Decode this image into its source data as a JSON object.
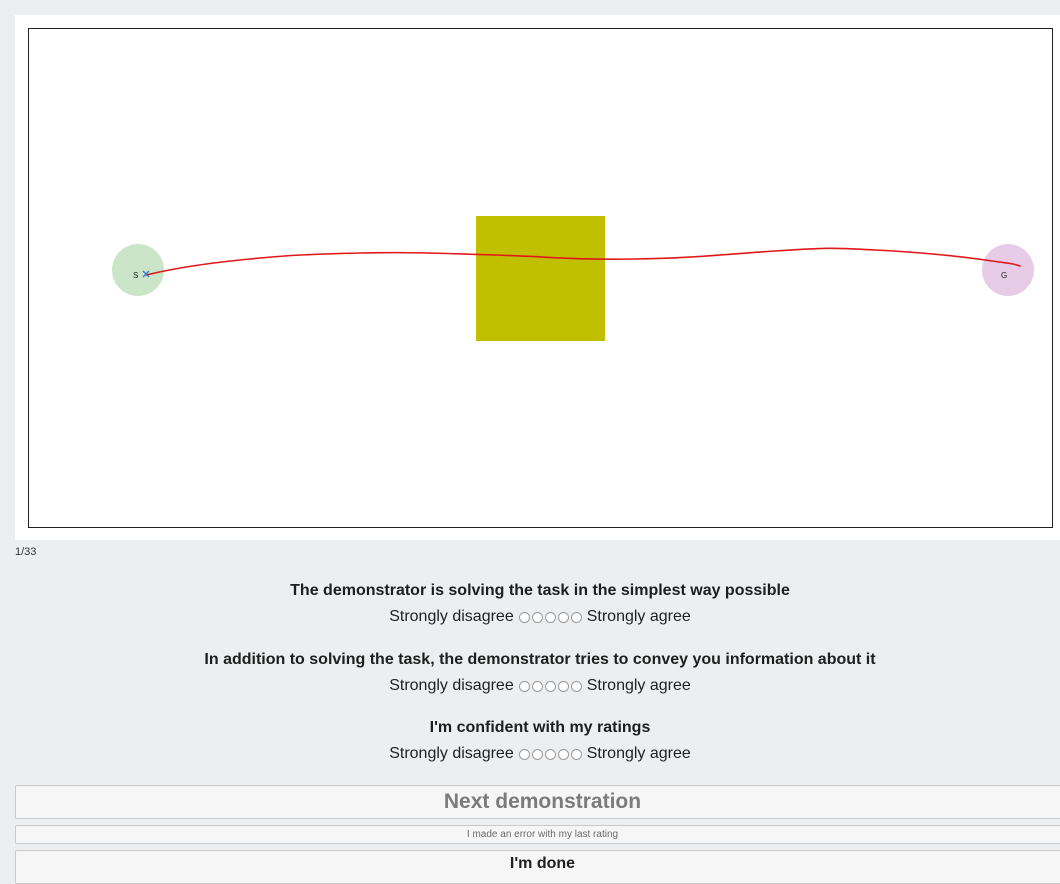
{
  "demo": {
    "start_label": "S",
    "goal_label": "G",
    "colors": {
      "start_circle": "#c5e2c3",
      "goal_circle": "#e5c7e4",
      "obstacle": "#c0c000",
      "trajectory": "#e01818",
      "start_marker": "#3a7ad0",
      "frame": "#222222"
    }
  },
  "progress": {
    "counter": "1/33"
  },
  "questions": [
    {
      "prompt": "The demonstrator is solving the task in the simplest way possible",
      "left_label": "Strongly disagree",
      "right_label": "Strongly agree",
      "options": 5
    },
    {
      "prompt": "In addition to solving the task, the demonstrator tries to convey you information about it",
      "left_label": "Strongly disagree",
      "right_label": "Strongly agree",
      "options": 5
    },
    {
      "prompt": "I'm confident with my ratings",
      "left_label": "Strongly disagree",
      "right_label": "Strongly agree",
      "options": 5
    }
  ],
  "buttons": {
    "next": "Next demonstration",
    "error": "I made an error with my last rating",
    "done": "I'm done"
  }
}
